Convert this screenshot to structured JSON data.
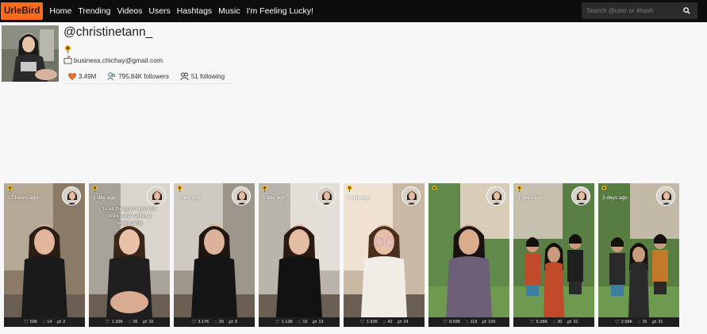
{
  "nav": {
    "brand": "UrleBird",
    "links": [
      "Home",
      "Trending",
      "Videos",
      "Users",
      "Hashtags",
      "Music",
      "I'm Feeling Lucky!"
    ],
    "search_placeholder": "Search @user or #hash"
  },
  "profile": {
    "username": "@christinetann_",
    "email": "business.chichay@gmail.com",
    "likes": "3.49M",
    "followers": "795.84K followers",
    "following": "51 following"
  },
  "videos": [
    {
      "time": "17 hours ago",
      "caption": "",
      "likes": "596",
      "comments": "14",
      "shares": "2"
    },
    {
      "time": "1 day ago",
      "caption": "to all the guys i ignored while i was still in a relationship",
      "likes": "1.39K",
      "comments": "26",
      "shares": "16"
    },
    {
      "time": "1 day ago",
      "caption": "",
      "likes": "3.17K",
      "comments": "20",
      "shares": "9"
    },
    {
      "time": "1 day ago",
      "caption": "",
      "likes": "1.13K",
      "comments": "15",
      "shares": "13"
    },
    {
      "time": "1 day ago",
      "caption": "",
      "likes": "1.92K",
      "comments": "42",
      "shares": "24"
    },
    {
      "time": "",
      "caption": "",
      "likes": "9.59K",
      "comments": "118",
      "shares": "109"
    },
    {
      "time": "3 days ago",
      "caption": "",
      "likes": "5.38K",
      "comments": "30",
      "shares": "31"
    },
    {
      "time": "3 days ago",
      "caption": "",
      "likes": "2.58K",
      "comments": "15",
      "shares": "31"
    }
  ],
  "colors": {
    "brand": "#ff6a1a",
    "navbar": "#0d0d0d",
    "stat_bar": "#1e1e1e"
  }
}
